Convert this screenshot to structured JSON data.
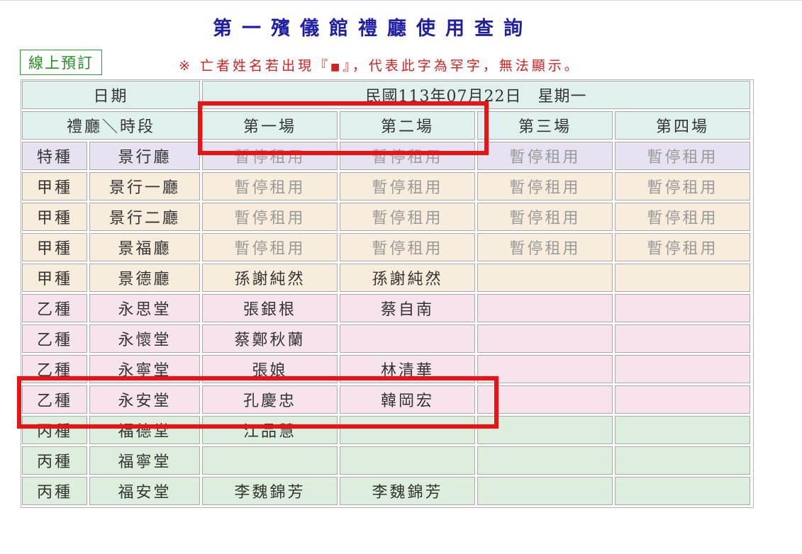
{
  "title": "第一殯儀館禮廳使用查詢",
  "online_booking_label": "線上預訂",
  "notice": {
    "prefix": "※ 亡者姓名若出現『",
    "symbol": "■",
    "suffix": "』，代表此字為罕字，無法顯示。"
  },
  "header": {
    "date_label": "日期",
    "date_value": "民國113年07月22日　星期一",
    "hall_timeslot_label": "禮廳＼時段",
    "slots": [
      "第一場",
      "第二場",
      "第三場",
      "第四場"
    ]
  },
  "rows": [
    {
      "type": "特種",
      "hall": "景行廳",
      "cells": [
        "暫停租用",
        "暫停租用",
        "暫停租用",
        "暫停租用"
      ],
      "tier": "special"
    },
    {
      "type": "甲種",
      "hall": "景行一廳",
      "cells": [
        "暫停租用",
        "暫停租用",
        "暫停租用",
        "暫停租用"
      ],
      "tier": "jia"
    },
    {
      "type": "甲種",
      "hall": "景行二廳",
      "cells": [
        "暫停租用",
        "暫停租用",
        "暫停租用",
        "暫停租用"
      ],
      "tier": "jia"
    },
    {
      "type": "甲種",
      "hall": "景福廳",
      "cells": [
        "暫停租用",
        "暫停租用",
        "暫停租用",
        "暫停租用"
      ],
      "tier": "jia"
    },
    {
      "type": "甲種",
      "hall": "景德廳",
      "cells": [
        "孫謝純然",
        "孫謝純然",
        "",
        ""
      ],
      "tier": "jia"
    },
    {
      "type": "乙種",
      "hall": "永思堂",
      "cells": [
        "張銀根",
        "蔡自南",
        "",
        ""
      ],
      "tier": "yi"
    },
    {
      "type": "乙種",
      "hall": "永懷堂",
      "cells": [
        "蔡鄭秋蘭",
        "",
        "",
        ""
      ],
      "tier": "yi"
    },
    {
      "type": "乙種",
      "hall": "永寧堂",
      "cells": [
        "張娘",
        "林清華",
        "",
        ""
      ],
      "tier": "yi"
    },
    {
      "type": "乙種",
      "hall": "永安堂",
      "cells": [
        "孔慶忠",
        "韓岡宏",
        "",
        ""
      ],
      "tier": "yi"
    },
    {
      "type": "丙種",
      "hall": "福德堂",
      "cells": [
        "江品慧",
        "",
        "",
        ""
      ],
      "tier": "bing"
    },
    {
      "type": "丙種",
      "hall": "福寧堂",
      "cells": [
        "",
        "",
        "",
        ""
      ],
      "tier": "bing"
    },
    {
      "type": "丙種",
      "hall": "福安堂",
      "cells": [
        "李魏錦芳",
        "李魏錦芳",
        "",
        ""
      ],
      "tier": "bing"
    }
  ],
  "colors": {
    "title": "#1f1fa6",
    "notice": "#d42222",
    "header_bg": "#dff0ee",
    "special_bg": "#e6e2f2",
    "jia_bg": "#f8ecdc",
    "yi_bg": "#f6e3ee",
    "bing_bg": "#ddeedd",
    "highlight_box": "#ee1111"
  }
}
